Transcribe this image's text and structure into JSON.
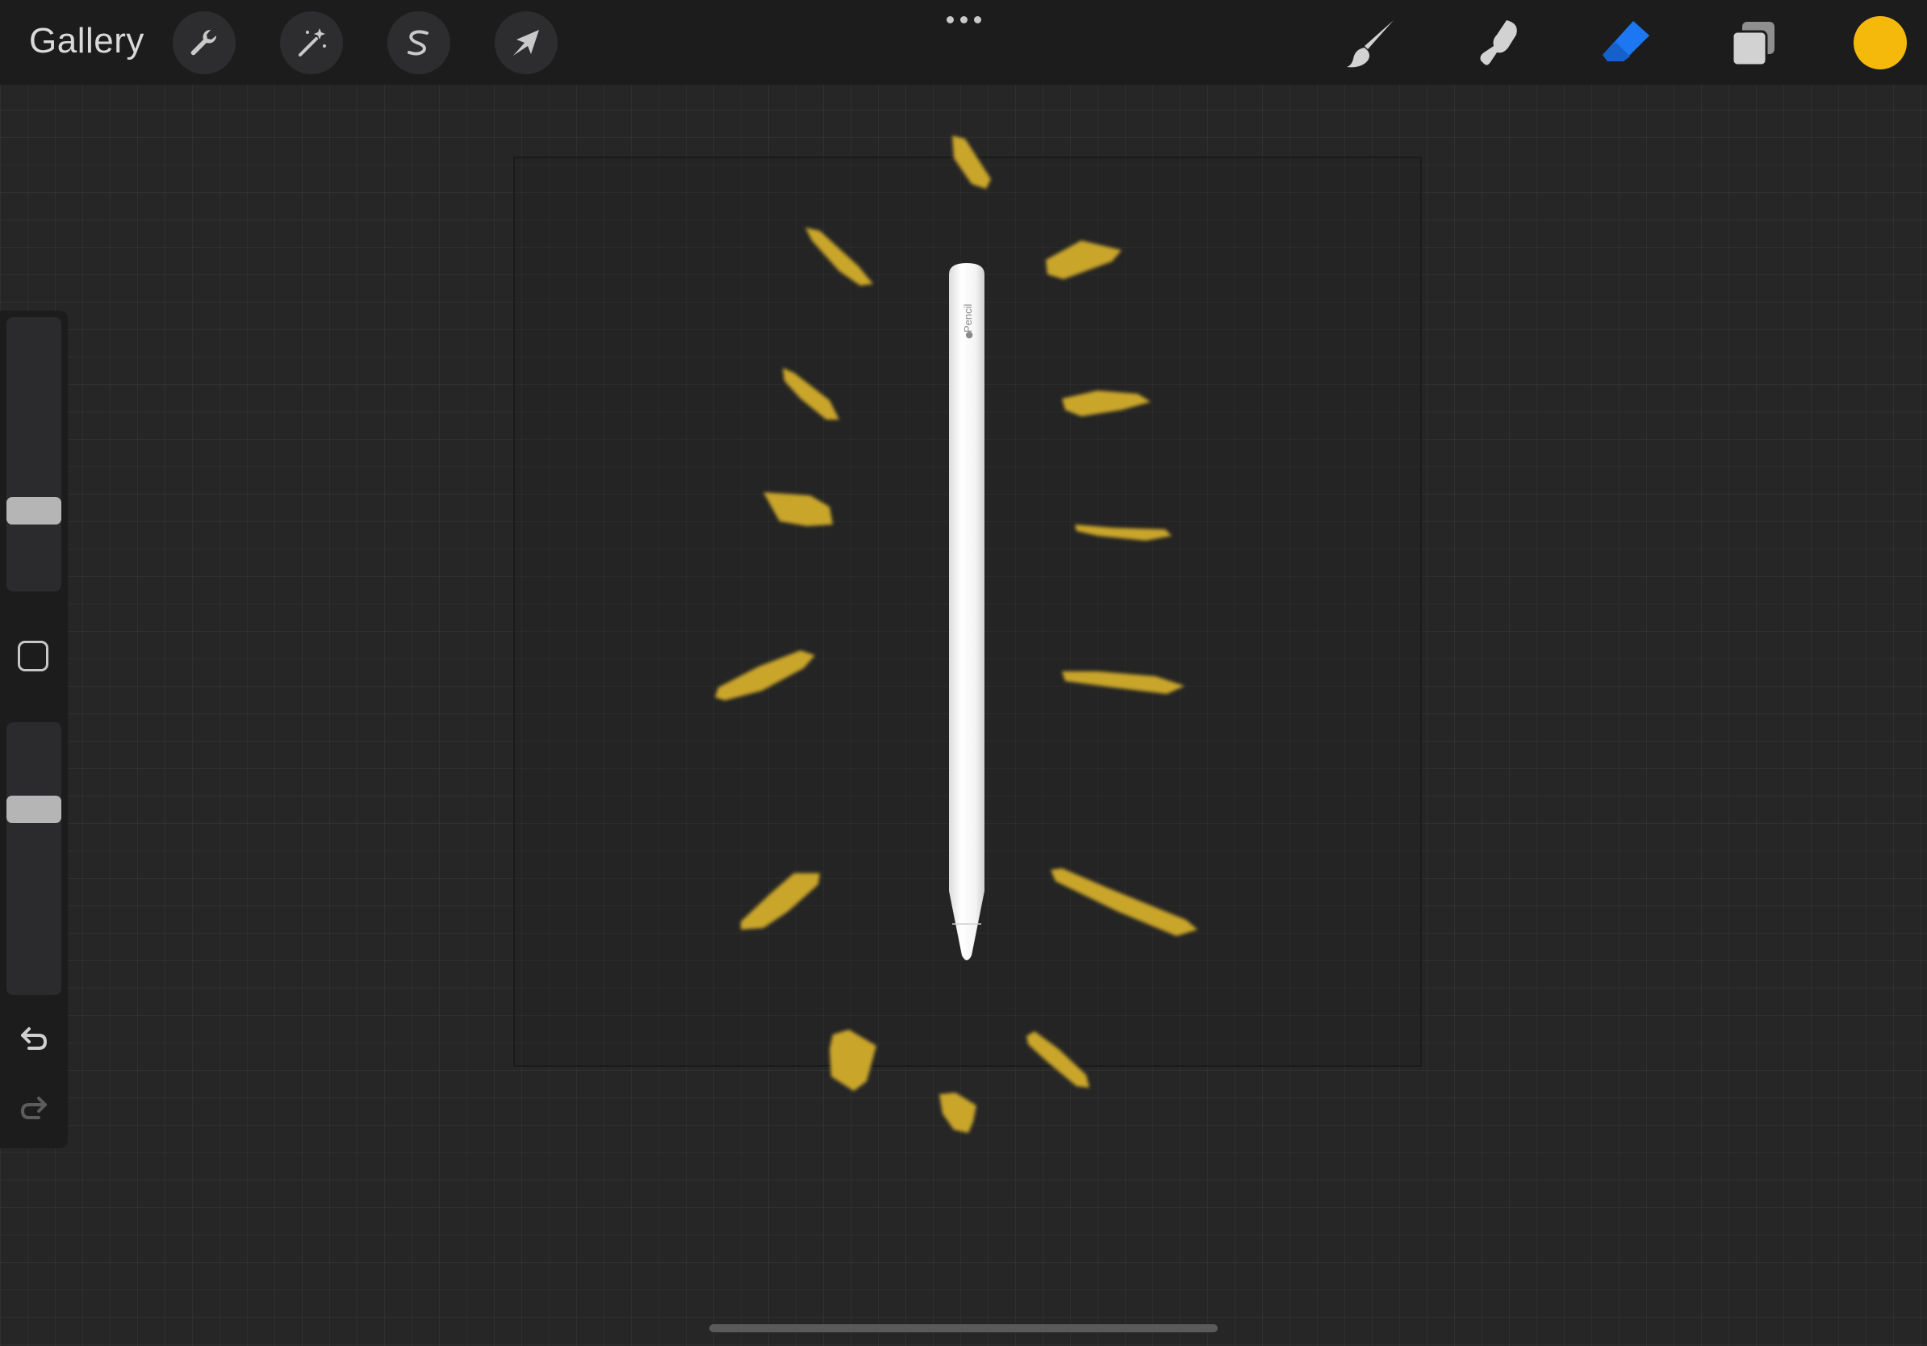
{
  "topbar": {
    "gallery_label": "Gallery",
    "left_tools": [
      "wrench-icon",
      "magic-wand-icon",
      "selection-icon",
      "transform-arrow-icon"
    ],
    "right_tools": [
      "brush-icon",
      "smudge-icon",
      "eraser-icon",
      "layers-icon"
    ],
    "active_tool": "eraser-icon",
    "accent_color": "#1d77f2"
  },
  "current_color": "#f4b90a",
  "sidebar": {
    "brush_size_level": 0.27,
    "opacity_level": 0.3,
    "icons": [
      "modify-square-icon",
      "undo-icon",
      "redo-icon"
    ]
  },
  "canvas": {
    "stroke_color": "#c9a52a",
    "pencil_label": "Pencil"
  }
}
